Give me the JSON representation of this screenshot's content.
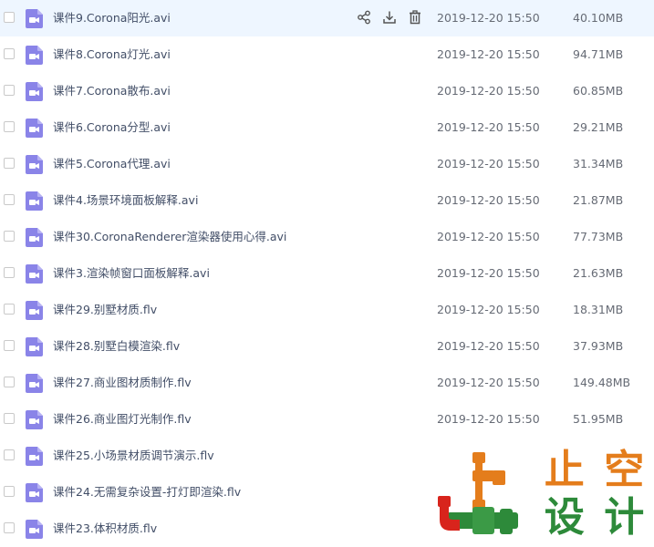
{
  "colors": {
    "row_highlight": "#eef6ff",
    "file_icon": "#8a84e8",
    "text_primary": "#424e67",
    "text_secondary": "#666b75",
    "logo_orange": "#e47d1c",
    "logo_green": "#2d8a3a",
    "logo_red": "#d8241c"
  },
  "row_actions": {
    "share_icon": "share-icon",
    "download_icon": "download-icon",
    "delete_icon": "trash-icon"
  },
  "files": [
    {
      "name": "课件9.Corona阳光.avi",
      "date": "2019-12-20 15:50",
      "size": "40.10MB",
      "icon": "video-icon",
      "hovered": true
    },
    {
      "name": "课件8.Corona灯光.avi",
      "date": "2019-12-20 15:50",
      "size": "94.71MB",
      "icon": "video-icon",
      "hovered": false
    },
    {
      "name": "课件7.Corona散布.avi",
      "date": "2019-12-20 15:50",
      "size": "60.85MB",
      "icon": "video-icon",
      "hovered": false
    },
    {
      "name": "课件6.Corona分型.avi",
      "date": "2019-12-20 15:50",
      "size": "29.21MB",
      "icon": "video-icon",
      "hovered": false
    },
    {
      "name": "课件5.Corona代理.avi",
      "date": "2019-12-20 15:50",
      "size": "31.34MB",
      "icon": "video-icon",
      "hovered": false
    },
    {
      "name": "课件4.场景环境面板解释.avi",
      "date": "2019-12-20 15:50",
      "size": "21.87MB",
      "icon": "video-icon",
      "hovered": false
    },
    {
      "name": "课件30.CoronaRenderer渲染器使用心得.avi",
      "date": "2019-12-20 15:50",
      "size": "77.73MB",
      "icon": "video-icon",
      "hovered": false
    },
    {
      "name": "课件3.渲染帧窗口面板解释.avi",
      "date": "2019-12-20 15:50",
      "size": "21.63MB",
      "icon": "video-icon",
      "hovered": false
    },
    {
      "name": "课件29.别墅材质.flv",
      "date": "2019-12-20 15:50",
      "size": "18.31MB",
      "icon": "video-icon",
      "hovered": false
    },
    {
      "name": "课件28.别墅白模渲染.flv",
      "date": "2019-12-20 15:50",
      "size": "37.93MB",
      "icon": "video-icon",
      "hovered": false
    },
    {
      "name": "课件27.商业图材质制作.flv",
      "date": "2019-12-20 15:50",
      "size": "149.48MB",
      "icon": "video-icon",
      "hovered": false
    },
    {
      "name": "课件26.商业图灯光制作.flv",
      "date": "2019-12-20 15:50",
      "size": "51.95MB",
      "icon": "video-icon",
      "hovered": false
    },
    {
      "name": "课件25.小场景材质调节演示.flv",
      "date": "",
      "size": "",
      "icon": "video-icon",
      "hovered": false
    },
    {
      "name": "课件24.无需复杂设置-打灯即渲染.flv",
      "date": "",
      "size": "",
      "icon": "video-icon",
      "hovered": false
    },
    {
      "name": "课件23.体积材质.flv",
      "date": "",
      "size": "",
      "icon": "video-icon",
      "hovered": false
    }
  ],
  "watermark": {
    "logo_text": [
      "止",
      "空",
      "设",
      "计"
    ]
  }
}
